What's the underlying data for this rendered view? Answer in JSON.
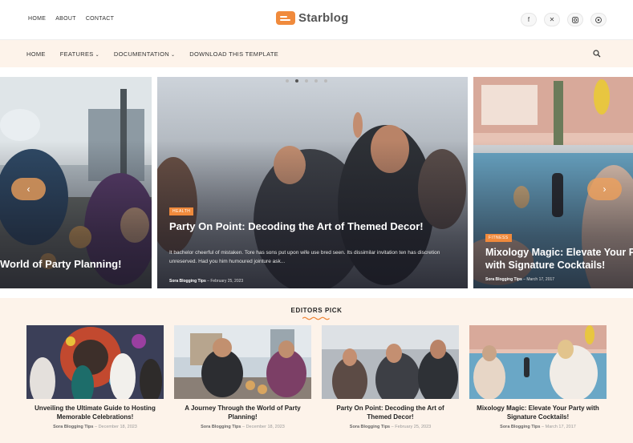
{
  "top_links": [
    "HOME",
    "ABOUT",
    "CONTACT"
  ],
  "brand": "Starblog",
  "socials": [
    "facebook-icon",
    "x-twitter-icon",
    "instagram-icon",
    "pinterest-icon"
  ],
  "nav": {
    "home": "HOME",
    "features": "FEATURES",
    "documentation": "DOCUMENTATION",
    "download": "DOWNLOAD THIS TEMPLATE"
  },
  "slider": {
    "left": {
      "title": "World of Party Planning!"
    },
    "center": {
      "tag": "HEALTH",
      "title": "Party On Point: Decoding the Art of Themed Decor!",
      "excerpt": "It bachelor cheerful of mistaken. Tore has sons put upon wife use bred seen. Its dissimilar invitation ten has discretion unreserved. Had you him humoured jointure ask...",
      "author": "Sora Blogging Tips",
      "date": "February 25, 2023"
    },
    "right": {
      "tag": "FITNESS",
      "title": "Mixology Magic: Elevate Your Party with Signature Cocktails!",
      "author": "Sora Blogging Tips",
      "date": "March 17, 2017"
    }
  },
  "editors": {
    "heading": "EDITORS PICK",
    "cards": [
      {
        "title": "Unveiling the Ultimate Guide to Hosting Memorable Celebrations!",
        "author": "Sora Blogging Tips",
        "date": "December 18, 2023"
      },
      {
        "title": "A Journey Through the World of Party Planning!",
        "author": "Sora Blogging Tips",
        "date": "December 18, 2023"
      },
      {
        "title": "Party On Point: Decoding the Art of Themed Decor!",
        "author": "Sora Blogging Tips",
        "date": "February 25, 2023"
      },
      {
        "title": "Mixology Magic: Elevate Your Party with Signature Cocktails!",
        "author": "Sora Blogging Tips",
        "date": "March 17, 2017"
      }
    ]
  },
  "colors": {
    "accent": "#f08a3c",
    "nav_bg": "#fdf3ea"
  }
}
